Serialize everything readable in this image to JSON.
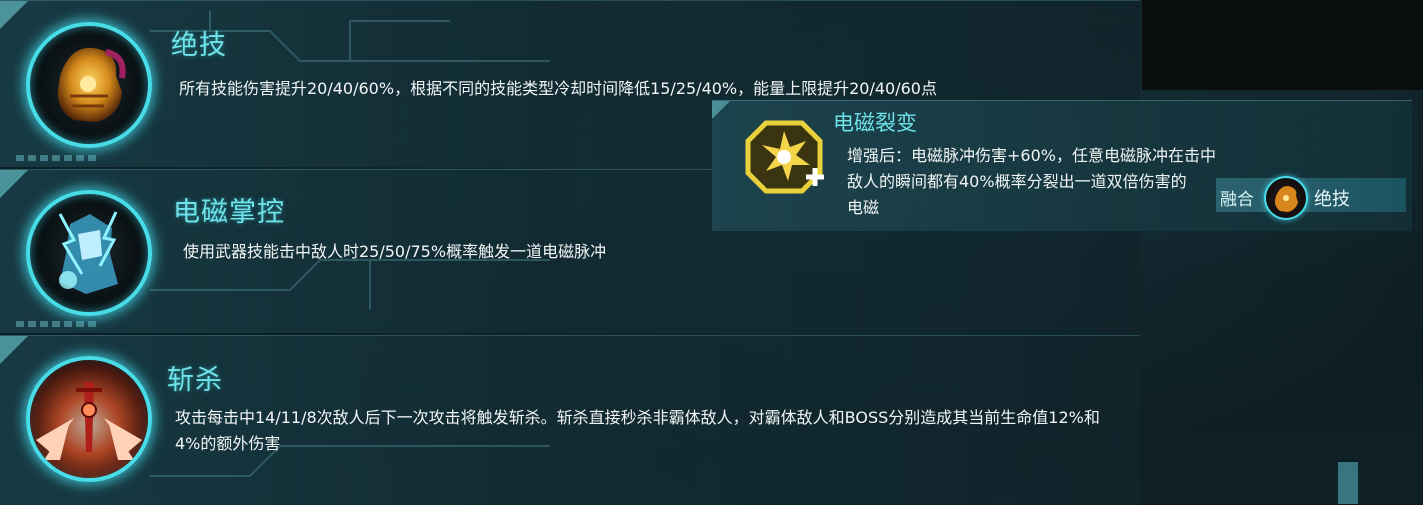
{
  "skills": [
    {
      "title": "绝技",
      "description": "所有技能伤害提升20/40/60%，根据不同的技能类型冷却时间降低15/25/40%，能量上限提升20/40/60点",
      "icon": "golden-gauntlet-icon"
    },
    {
      "title": "电磁掌控",
      "description": "使用武器技能击中敌人时25/50/75%概率触发一道电磁脉冲",
      "icon": "electric-warrior-icon"
    },
    {
      "title": "斩杀",
      "description_line1": "攻击每击中14/11/8次敌人后下一次攻击将触发斩杀。斩杀直接秒杀非霸体敌人，对霸体敌人和BOSS分别造成其当前生命值12%和",
      "description_line2": "4%的额外伤害",
      "icon": "flaming-sword-icon"
    }
  ],
  "tooltip": {
    "title": "电磁裂变",
    "description_line1": "增强后：电磁脉冲伤害+60%，任意电磁脉冲在击中",
    "description_line2": "敌人的瞬间都有40%概率分裂出一道双倍伤害的",
    "description_line3": "电磁",
    "icon": "electric-burst-plus-icon",
    "fusion_label": "融合",
    "fusion_skill": "绝技"
  },
  "colors": {
    "accent": "#48dce8",
    "title_text": "#6fe2ea",
    "body_text": "#f2f6f6"
  }
}
